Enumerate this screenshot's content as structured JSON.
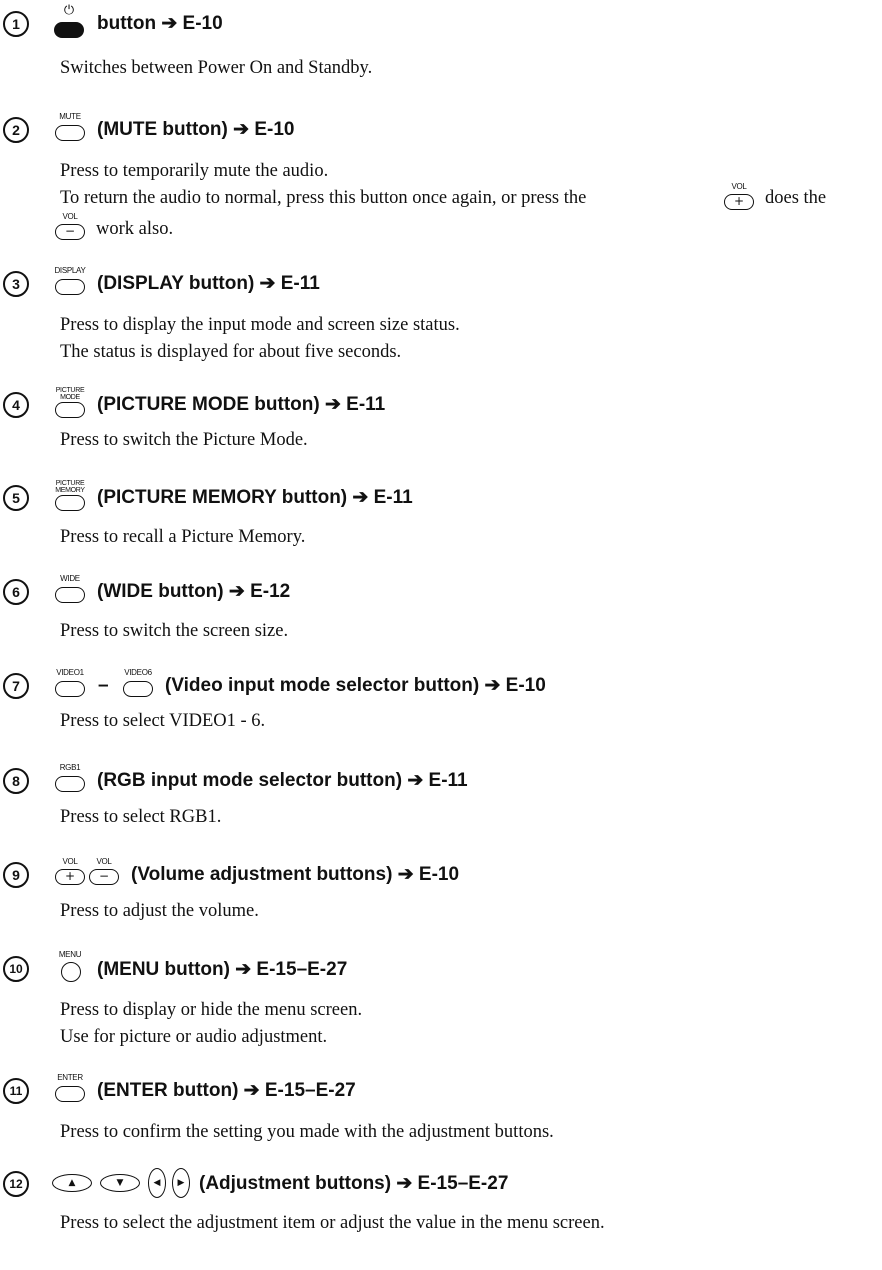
{
  "entries": [
    {
      "number": "1",
      "buttons": [
        "power"
      ],
      "title": "button ➔ E-10",
      "lines": [
        "Switches between Power On and Standby."
      ]
    },
    {
      "number": "2",
      "buttons": [
        "MUTE"
      ],
      "title": "(MUTE button) ➔ E-10",
      "lines": [
        "Press to temporarily mute the audio.",
        "To return the audio to normal, press this button once again, or press the",
        "does the",
        "work also."
      ]
    },
    {
      "number": "3",
      "buttons": [
        "DISPLAY"
      ],
      "title": "(DISPLAY button) ➔ E-11",
      "lines": [
        "Press to display the input mode and screen size status.",
        "The status is displayed for about five seconds."
      ]
    },
    {
      "number": "4",
      "buttons": [
        "PICTURE",
        "MODE"
      ],
      "title": "(PICTURE MODE button) ➔ E-11",
      "lines": [
        "Press to switch the Picture Mode."
      ]
    },
    {
      "number": "5",
      "buttons": [
        "PICTURE",
        "MEMORY"
      ],
      "title": "(PICTURE MEMORY button) ➔ E-11",
      "lines": [
        "Press to recall a Picture Memory."
      ]
    },
    {
      "number": "6",
      "buttons": [
        "WIDE"
      ],
      "title": "(WIDE button) ➔ E-12",
      "lines": [
        "Press to switch the screen size."
      ]
    },
    {
      "number": "7",
      "buttons": [
        "VIDEO1",
        "VIDEO6"
      ],
      "dash": "–",
      "title": "(Video input mode selector button) ➔ E-10",
      "lines": [
        "Press to select VIDEO1 - 6."
      ]
    },
    {
      "number": "8",
      "buttons": [
        "RGB1"
      ],
      "title": "(RGB input mode selector button) ➔ E-11",
      "lines": [
        "Press to select RGB1."
      ]
    },
    {
      "number": "9",
      "buttons": [
        "VOL",
        "VOL"
      ],
      "title": "(Volume adjustment buttons) ➔ E-10",
      "lines": [
        "Press to adjust the volume."
      ]
    },
    {
      "number": "10",
      "buttons": [
        "MENU"
      ],
      "title": "(MENU button) ➔ E-15–E-27",
      "lines": [
        "Press to display or hide the menu screen.",
        "Use for picture or audio adjustment."
      ]
    },
    {
      "number": "11",
      "buttons": [
        "ENTER"
      ],
      "title": "(ENTER button) ➔ E-15–E-27",
      "lines": [
        "Press to confirm the setting you made with the adjustment buttons."
      ]
    },
    {
      "number": "12",
      "buttons": [
        "up",
        "down",
        "left",
        "right"
      ],
      "title": "(Adjustment buttons) ➔ E-15–E-27",
      "lines": [
        "Press to select the adjustment item or adjust the value in the menu screen."
      ]
    }
  ]
}
